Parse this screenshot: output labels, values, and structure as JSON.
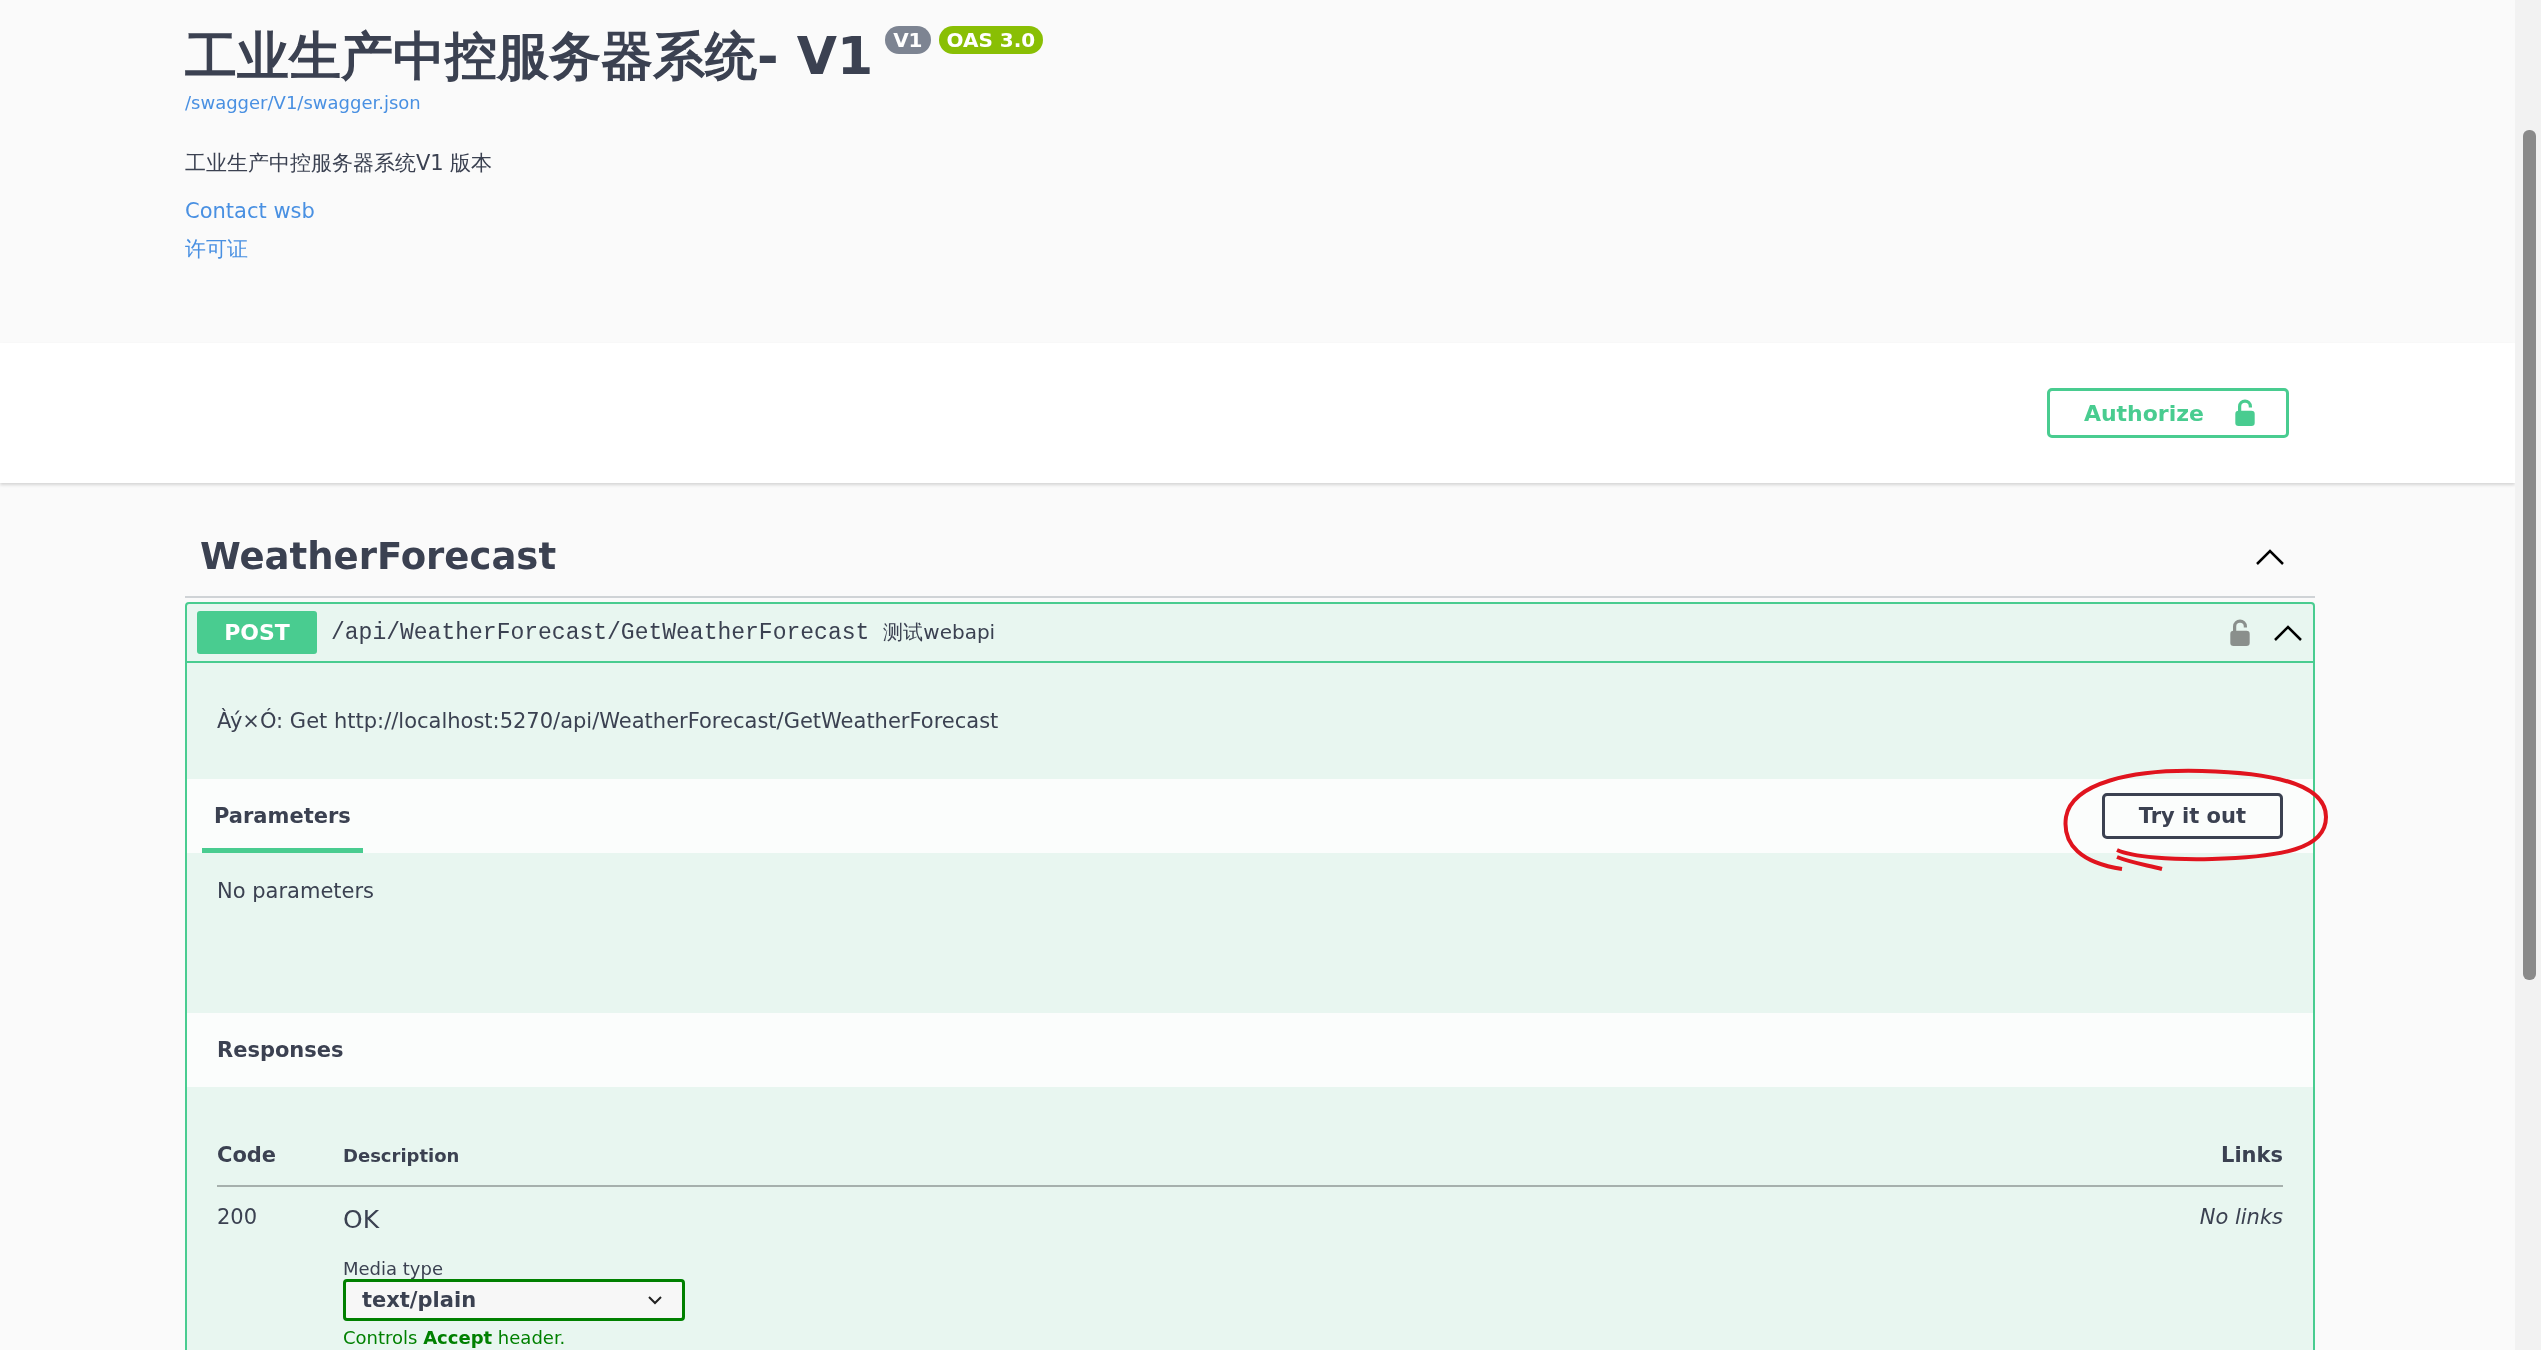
{
  "info": {
    "title": "工业生产中控服务器系统- V1",
    "badges": [
      {
        "text": "V1",
        "kind": "version"
      },
      {
        "text": "OAS 3.0",
        "kind": "oas"
      }
    ],
    "spec_link": "/swagger/V1/swagger.json",
    "description": "工业生产中控服务器系统V1 版本",
    "contact_link": "Contact wsb",
    "license_link": "许可证"
  },
  "authorize_button": {
    "label": "Authorize"
  },
  "section": {
    "title": "WeatherForecast",
    "expanded": true,
    "operation": {
      "method": "POST",
      "path": "/api/WeatherForecast/GetWeatherForecast",
      "summary": "测试webapi",
      "expanded": true,
      "description": "Àý×Ó: Get http://localhost:5270/api/WeatherForecast/GetWeatherForecast",
      "parameters_tab": {
        "label": "Parameters",
        "selected": true
      },
      "try_button": "Try it out",
      "no_parameters": "No parameters",
      "responses_title": "Responses",
      "columns": [
        "Code",
        "Description",
        "Links"
      ],
      "responses": [
        {
          "code": "200",
          "description": "OK",
          "media_type_label": "Media type",
          "media_type": "text/plain",
          "controls_note": "Controls **Accept** header.",
          "links": "No links"
        }
      ]
    }
  }
}
